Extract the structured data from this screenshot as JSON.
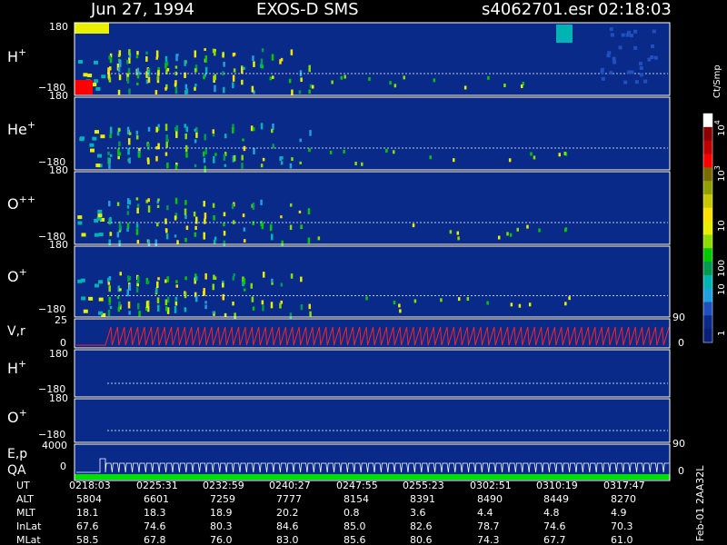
{
  "header": {
    "date": "Jun 27, 1994",
    "instrument": "EXOS-D SMS",
    "file": "s4062701.esr",
    "time": "02:18:03"
  },
  "colorbar": {
    "unit_label": "Ct/Smp",
    "tick_labels": [
      "10",
      "10",
      "10",
      "100",
      "10",
      "1"
    ],
    "tick_sups": [
      "4",
      "3",
      "",
      "",
      "",
      ""
    ],
    "colors": [
      "#ffffff",
      "#8b0000",
      "#c00000",
      "#ff0000",
      "#7a6a00",
      "#8fa000",
      "#c8c800",
      "#ffe000",
      "#e8f000",
      "#8cdc00",
      "#00c800",
      "#009a50",
      "#00b4b4",
      "#20a0e0",
      "#2050c0",
      "#0a2a8a",
      "#08207a"
    ]
  },
  "panel_labels": {
    "h_plus": "H",
    "he_plus": "He",
    "o_plusplus": "O",
    "o_plus": "O",
    "vr": "V,r",
    "h_plus_2": "H",
    "o_plus_2": "O",
    "ep": "E,p",
    "qa": "QA",
    "sup_plus": "+",
    "sup_plusplus": "++"
  },
  "axis_ticks": {
    "pa_top": "180",
    "pa_bottom": "−180",
    "vr_top": "25",
    "vr_zero": "0",
    "vr_right": "90",
    "vr_right_zero": "0",
    "ep_top": "4000",
    "ep_zero": "0",
    "ep_right": "90",
    "ep_right_zero": "0"
  },
  "footer": {
    "row_labels": [
      "UT",
      "ALT",
      "MLT",
      "InLat",
      "MLat"
    ],
    "columns": [
      [
        "0218:03",
        "5804",
        "18.1",
        "67.6",
        "58.5"
      ],
      [
        "0225:31",
        "6601",
        "18.3",
        "74.6",
        "67.8"
      ],
      [
        "0232:59",
        "7259",
        "18.9",
        "80.3",
        "76.0"
      ],
      [
        "0240:27",
        "7777",
        "20.2",
        "84.6",
        "83.0"
      ],
      [
        "0247:55",
        "8154",
        "0.8",
        "85.0",
        "85.6"
      ],
      [
        "0255:23",
        "8391",
        "3.6",
        "82.6",
        "80.6"
      ],
      [
        "0302:51",
        "8490",
        "4.4",
        "78.7",
        "74.3"
      ],
      [
        "0310:19",
        "8449",
        "4.8",
        "74.6",
        "67.7"
      ],
      [
        "0317:47",
        "8270",
        "4.9",
        "70.3",
        "61.0"
      ]
    ],
    "side_label": "Feb-01 2AA32L"
  },
  "chart_data": {
    "type": "heatmap",
    "x_axis": {
      "label": "UT",
      "ticks": [
        "0218:03",
        "0225:31",
        "0232:59",
        "0240:27",
        "0247:55",
        "0255:23",
        "0302:51",
        "0310:19",
        "0317:47"
      ]
    },
    "panels": [
      {
        "name": "H+",
        "y_range": [
          -180,
          180
        ],
        "kind": "pitch-angle spectrogram"
      },
      {
        "name": "He+",
        "y_range": [
          -180,
          180
        ],
        "kind": "pitch-angle spectrogram"
      },
      {
        "name": "O++",
        "y_range": [
          -180,
          180
        ],
        "kind": "pitch-angle spectrogram"
      },
      {
        "name": "O+",
        "y_range": [
          -180,
          180
        ],
        "kind": "pitch-angle spectrogram"
      },
      {
        "name": "V,r",
        "y_range": [
          0,
          25
        ],
        "right_range": [
          0,
          90
        ],
        "kind": "line"
      },
      {
        "name": "H+",
        "y_range": [
          -180,
          180
        ],
        "kind": "pitch-angle spectrogram"
      },
      {
        "name": "O+",
        "y_range": [
          -180,
          180
        ],
        "kind": "pitch-angle spectrogram"
      },
      {
        "name": "E,p",
        "y_range": [
          0,
          4000
        ],
        "right_range": [
          0,
          90
        ],
        "kind": "line"
      }
    ],
    "colorbar": {
      "label": "Ct/Smp",
      "range": [
        1,
        10000
      ],
      "scale": "log"
    }
  }
}
